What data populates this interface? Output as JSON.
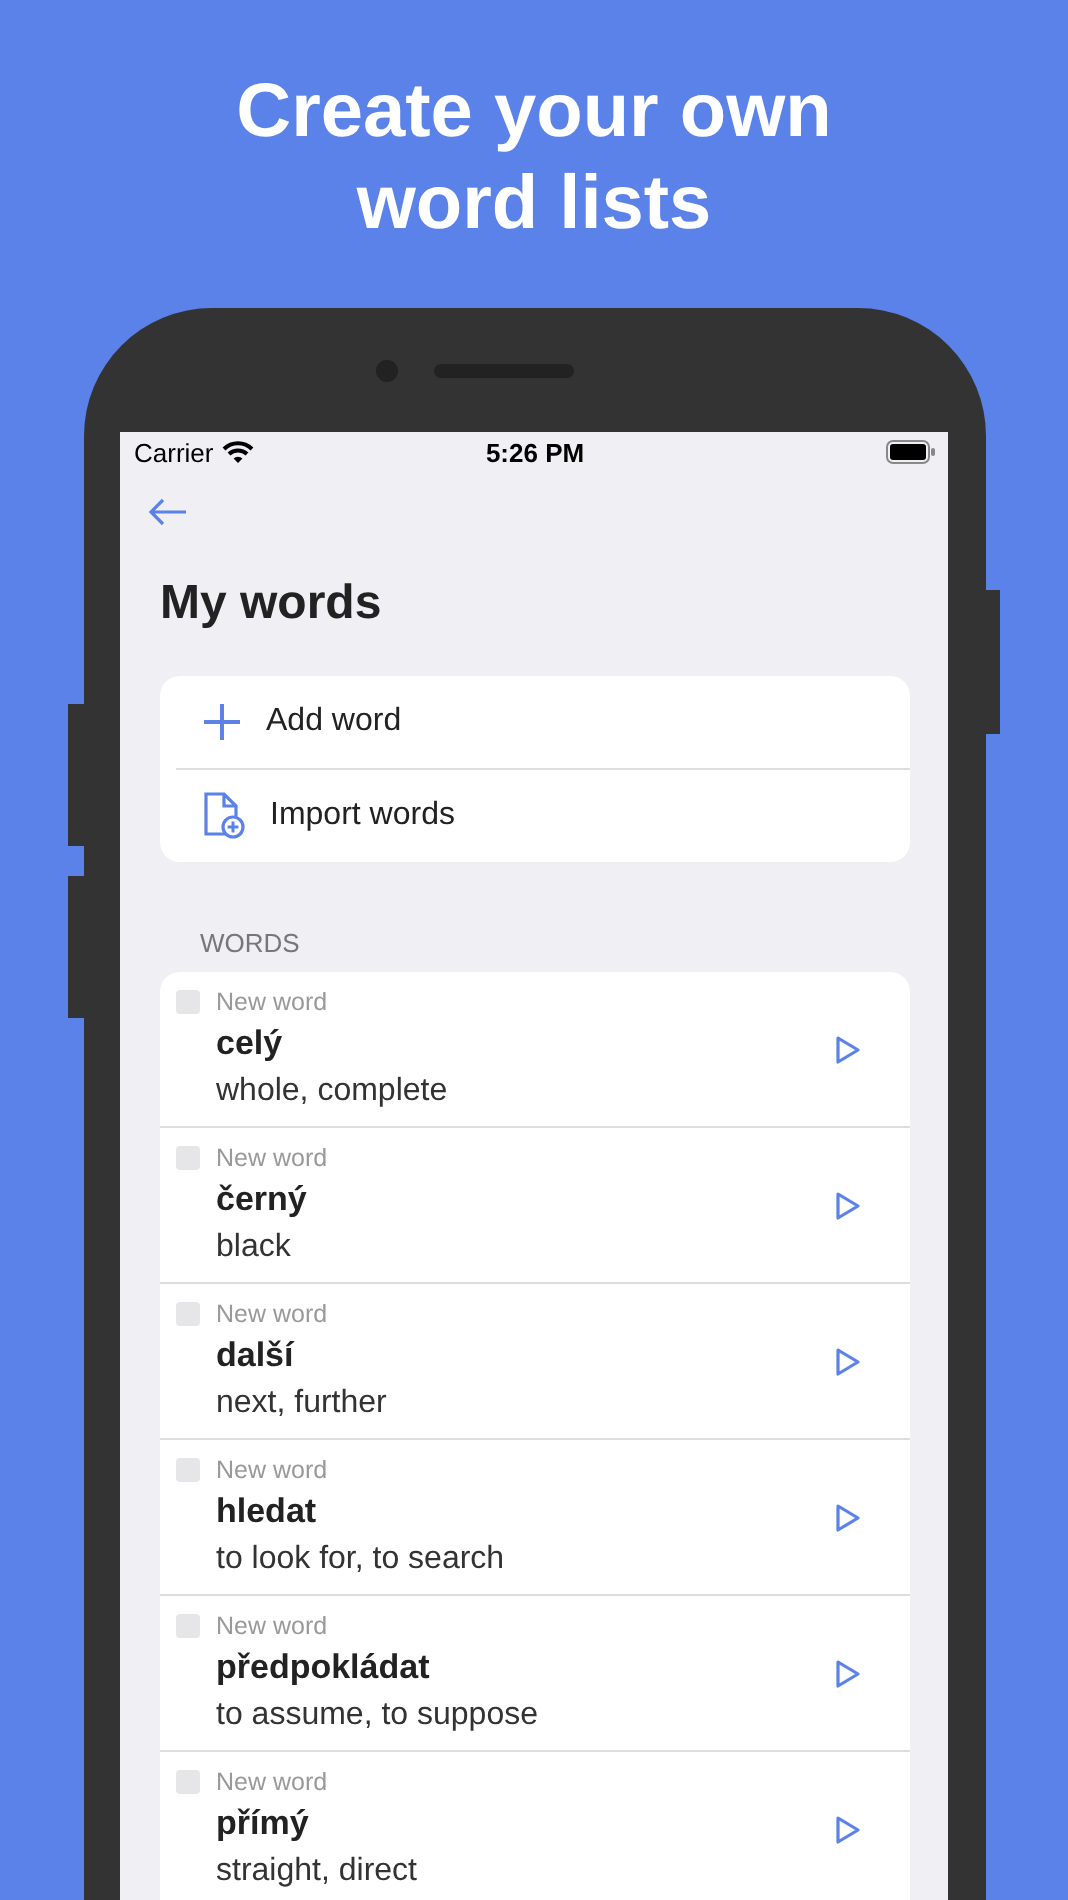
{
  "headline": [
    "Create your own",
    "word lists"
  ],
  "status_bar": {
    "carrier": "Carrier",
    "time": "5:26 PM"
  },
  "title": "My words",
  "actions": [
    {
      "kind": "add",
      "label": "Add word"
    },
    {
      "kind": "import",
      "label": "Import words"
    }
  ],
  "section_header": "WORDS",
  "words": [
    {
      "status": "New word",
      "word": "celý",
      "translation": "whole, complete"
    },
    {
      "status": "New word",
      "word": "černý",
      "translation": "black"
    },
    {
      "status": "New word",
      "word": "další",
      "translation": "next, further"
    },
    {
      "status": "New word",
      "word": "hledat",
      "translation": "to look for, to search"
    },
    {
      "status": "New word",
      "word": "předpokládat",
      "translation": "to assume, to suppose"
    },
    {
      "status": "New word",
      "word": "přímý",
      "translation": "straight, direct"
    }
  ]
}
